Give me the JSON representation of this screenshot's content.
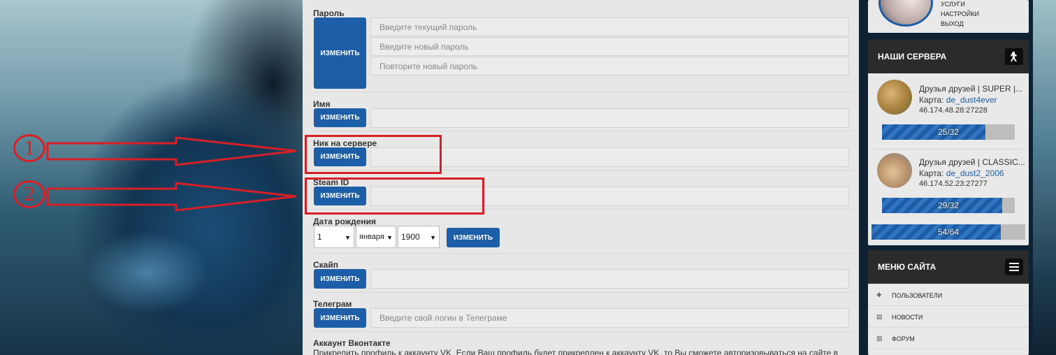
{
  "form": {
    "password": {
      "label": "Пароль",
      "button": "ИЗМЕНИТЬ",
      "current_placeholder": "Введите текущий пароль",
      "new_placeholder": "Введите новый пароль",
      "repeat_placeholder": "Повторите новый пароль"
    },
    "name": {
      "label": "Имя",
      "button": "ИЗМЕНИТЬ",
      "value": ""
    },
    "nick": {
      "label": "Ник на сервере",
      "button": "ИЗМЕНИТЬ",
      "value": ""
    },
    "steam": {
      "label": "Steam ID",
      "button": "ИЗМЕНИТЬ",
      "value": ""
    },
    "birthdate": {
      "label": "Дата рождения",
      "day": "1",
      "month": "января",
      "year": "1900",
      "button": "ИЗМЕНИТЬ"
    },
    "skype": {
      "label": "Скайп",
      "button": "ИЗМЕНИТЬ",
      "value": ""
    },
    "telegram": {
      "label": "Телеграм",
      "button": "ИЗМЕНИТЬ",
      "placeholder": "Введите свой логин в Телеграме"
    },
    "vk": {
      "label": "Аккаунт Вконтакте",
      "description": "Прикрепить профиль к аккаунту VK. Если Ваш профиль будет прикреплен к аккаунту VK, то Вы сможете авторизовываться на сайте в"
    }
  },
  "annotations": {
    "marker1": "1",
    "marker2": "2",
    "color": "#d91f26"
  },
  "sidebar": {
    "user_menu": [
      "УСЛУГИ",
      "НАСТРОЙКИ",
      "ВЫХОД"
    ],
    "servers": {
      "title": "НАШИ СЕРВЕРА",
      "items": [
        {
          "name": "Друзья друзей | SUPER |...",
          "map_label": "Карта:",
          "map": "de_dust4ever",
          "address": "46.174.48.28:27228",
          "players": "25/32",
          "fill": 0.78
        },
        {
          "name": "Друзья друзей | CLASSIC...",
          "map_label": "Карта:",
          "map": "de_dust2_2006",
          "address": "46.174.52.23:27277",
          "players": "29/32",
          "fill": 0.906
        }
      ],
      "total": "54/64",
      "total_fill": 0.84
    },
    "site_menu": {
      "title": "МЕНЮ САЙТА",
      "items": [
        "ПОЛЬЗОВАТЕЛИ",
        "НОВОСТИ",
        "ФОРУМ"
      ]
    }
  },
  "colors": {
    "accent": "#1d5ea8",
    "panel": "#e7e7e7",
    "header": "#2b2b2b"
  }
}
